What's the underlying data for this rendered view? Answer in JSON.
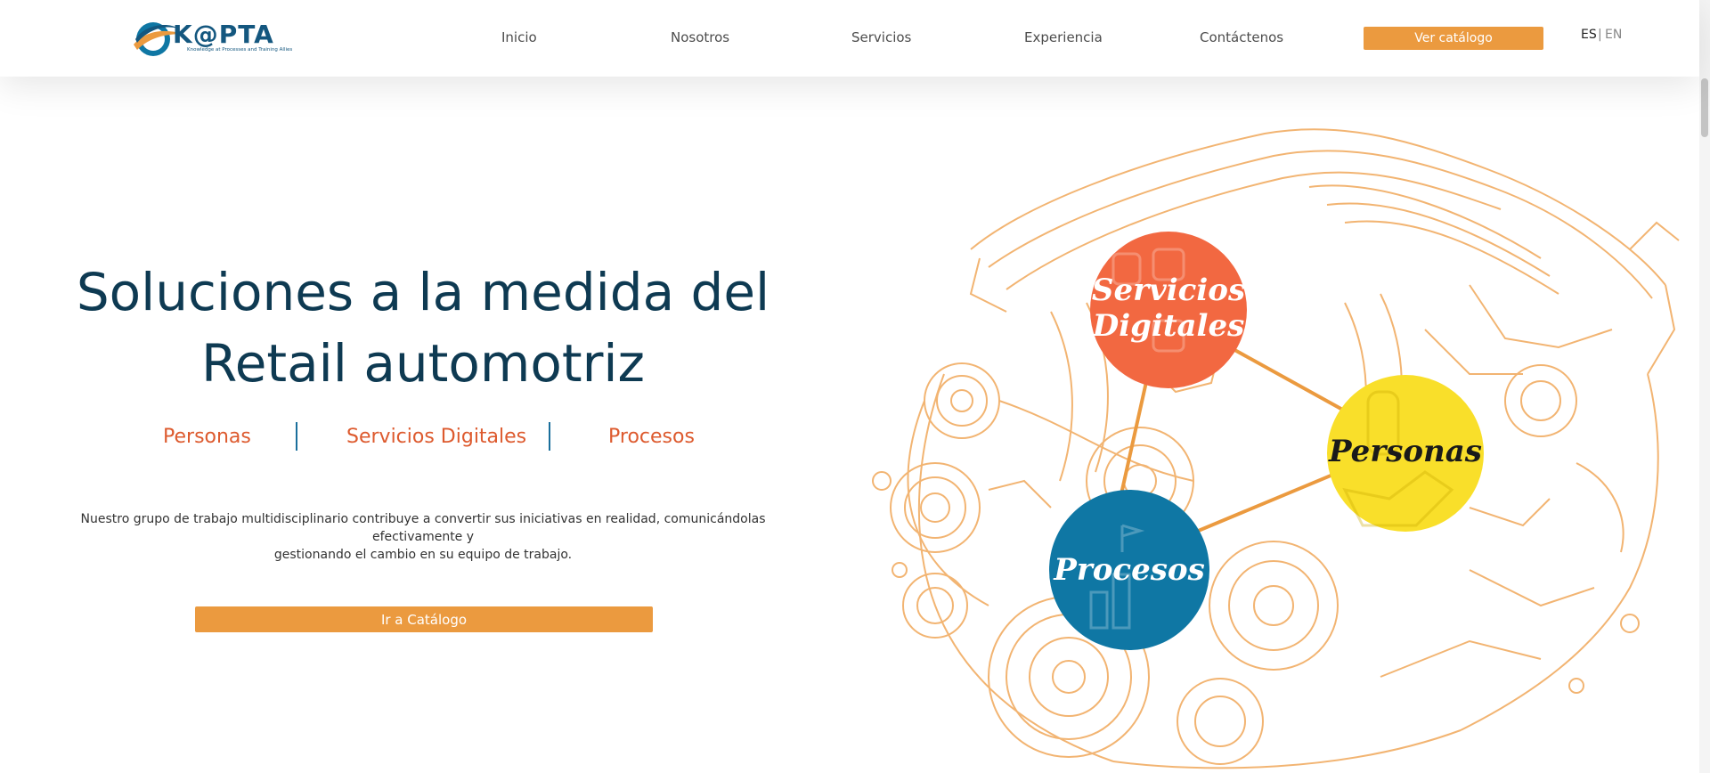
{
  "logo": {
    "wordmark": "K@PTA",
    "tagline": "Knowledge at Processes and Training Allies"
  },
  "nav": [
    "Inicio",
    "Nosotros",
    "Servicios",
    "Experiencia",
    "Contáctenos"
  ],
  "header_cta": "Ver catálogo",
  "languages": {
    "active": "ES",
    "separator": "|",
    "other": "EN"
  },
  "hero": {
    "title_line1": "Soluciones a la medida del",
    "title_line2": "Retail automotriz",
    "pillars": [
      "Personas",
      "Servicios Digitales",
      "Procesos"
    ],
    "description_line1": "Nuestro grupo de trabajo multidisciplinario contribuye a convertir sus iniciativas en realidad, comunicándolas efectivamente y",
    "description_line2": "gestionando el cambio en su equipo de trabajo.",
    "cta": "Ir a Catálogo"
  },
  "illustration": {
    "circle_servicios_line1": "Servicios",
    "circle_servicios_line2": "Digitales",
    "circle_personas": "Personas",
    "circle_procesos": "Procesos"
  },
  "colors": {
    "brand_dark": "#0e3a52",
    "accent_orange": "#eb9a3f",
    "pillar_text": "#dd5a2e",
    "circle_servicios": "#f26841",
    "circle_personas": "#f9df2a",
    "circle_procesos": "#0f77a4",
    "engine_lines": "#f0a85a"
  }
}
